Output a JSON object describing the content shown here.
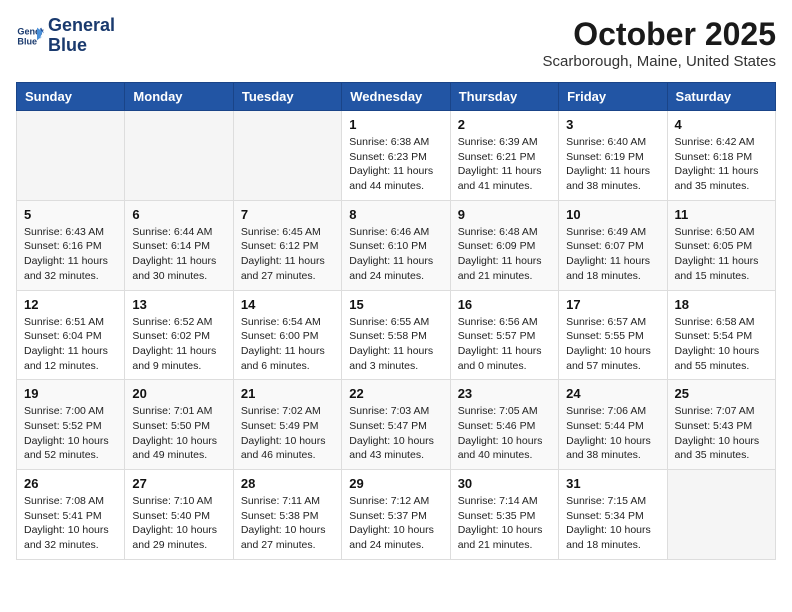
{
  "header": {
    "logo": {
      "line1": "General",
      "line2": "Blue"
    },
    "title": "October 2025",
    "location": "Scarborough, Maine, United States"
  },
  "weekdays": [
    "Sunday",
    "Monday",
    "Tuesday",
    "Wednesday",
    "Thursday",
    "Friday",
    "Saturday"
  ],
  "weeks": [
    [
      {
        "day": "",
        "info": ""
      },
      {
        "day": "",
        "info": ""
      },
      {
        "day": "",
        "info": ""
      },
      {
        "day": "1",
        "info": "Sunrise: 6:38 AM\nSunset: 6:23 PM\nDaylight: 11 hours\nand 44 minutes."
      },
      {
        "day": "2",
        "info": "Sunrise: 6:39 AM\nSunset: 6:21 PM\nDaylight: 11 hours\nand 41 minutes."
      },
      {
        "day": "3",
        "info": "Sunrise: 6:40 AM\nSunset: 6:19 PM\nDaylight: 11 hours\nand 38 minutes."
      },
      {
        "day": "4",
        "info": "Sunrise: 6:42 AM\nSunset: 6:18 PM\nDaylight: 11 hours\nand 35 minutes."
      }
    ],
    [
      {
        "day": "5",
        "info": "Sunrise: 6:43 AM\nSunset: 6:16 PM\nDaylight: 11 hours\nand 32 minutes."
      },
      {
        "day": "6",
        "info": "Sunrise: 6:44 AM\nSunset: 6:14 PM\nDaylight: 11 hours\nand 30 minutes."
      },
      {
        "day": "7",
        "info": "Sunrise: 6:45 AM\nSunset: 6:12 PM\nDaylight: 11 hours\nand 27 minutes."
      },
      {
        "day": "8",
        "info": "Sunrise: 6:46 AM\nSunset: 6:10 PM\nDaylight: 11 hours\nand 24 minutes."
      },
      {
        "day": "9",
        "info": "Sunrise: 6:48 AM\nSunset: 6:09 PM\nDaylight: 11 hours\nand 21 minutes."
      },
      {
        "day": "10",
        "info": "Sunrise: 6:49 AM\nSunset: 6:07 PM\nDaylight: 11 hours\nand 18 minutes."
      },
      {
        "day": "11",
        "info": "Sunrise: 6:50 AM\nSunset: 6:05 PM\nDaylight: 11 hours\nand 15 minutes."
      }
    ],
    [
      {
        "day": "12",
        "info": "Sunrise: 6:51 AM\nSunset: 6:04 PM\nDaylight: 11 hours\nand 12 minutes."
      },
      {
        "day": "13",
        "info": "Sunrise: 6:52 AM\nSunset: 6:02 PM\nDaylight: 11 hours\nand 9 minutes."
      },
      {
        "day": "14",
        "info": "Sunrise: 6:54 AM\nSunset: 6:00 PM\nDaylight: 11 hours\nand 6 minutes."
      },
      {
        "day": "15",
        "info": "Sunrise: 6:55 AM\nSunset: 5:58 PM\nDaylight: 11 hours\nand 3 minutes."
      },
      {
        "day": "16",
        "info": "Sunrise: 6:56 AM\nSunset: 5:57 PM\nDaylight: 11 hours\nand 0 minutes."
      },
      {
        "day": "17",
        "info": "Sunrise: 6:57 AM\nSunset: 5:55 PM\nDaylight: 10 hours\nand 57 minutes."
      },
      {
        "day": "18",
        "info": "Sunrise: 6:58 AM\nSunset: 5:54 PM\nDaylight: 10 hours\nand 55 minutes."
      }
    ],
    [
      {
        "day": "19",
        "info": "Sunrise: 7:00 AM\nSunset: 5:52 PM\nDaylight: 10 hours\nand 52 minutes."
      },
      {
        "day": "20",
        "info": "Sunrise: 7:01 AM\nSunset: 5:50 PM\nDaylight: 10 hours\nand 49 minutes."
      },
      {
        "day": "21",
        "info": "Sunrise: 7:02 AM\nSunset: 5:49 PM\nDaylight: 10 hours\nand 46 minutes."
      },
      {
        "day": "22",
        "info": "Sunrise: 7:03 AM\nSunset: 5:47 PM\nDaylight: 10 hours\nand 43 minutes."
      },
      {
        "day": "23",
        "info": "Sunrise: 7:05 AM\nSunset: 5:46 PM\nDaylight: 10 hours\nand 40 minutes."
      },
      {
        "day": "24",
        "info": "Sunrise: 7:06 AM\nSunset: 5:44 PM\nDaylight: 10 hours\nand 38 minutes."
      },
      {
        "day": "25",
        "info": "Sunrise: 7:07 AM\nSunset: 5:43 PM\nDaylight: 10 hours\nand 35 minutes."
      }
    ],
    [
      {
        "day": "26",
        "info": "Sunrise: 7:08 AM\nSunset: 5:41 PM\nDaylight: 10 hours\nand 32 minutes."
      },
      {
        "day": "27",
        "info": "Sunrise: 7:10 AM\nSunset: 5:40 PM\nDaylight: 10 hours\nand 29 minutes."
      },
      {
        "day": "28",
        "info": "Sunrise: 7:11 AM\nSunset: 5:38 PM\nDaylight: 10 hours\nand 27 minutes."
      },
      {
        "day": "29",
        "info": "Sunrise: 7:12 AM\nSunset: 5:37 PM\nDaylight: 10 hours\nand 24 minutes."
      },
      {
        "day": "30",
        "info": "Sunrise: 7:14 AM\nSunset: 5:35 PM\nDaylight: 10 hours\nand 21 minutes."
      },
      {
        "day": "31",
        "info": "Sunrise: 7:15 AM\nSunset: 5:34 PM\nDaylight: 10 hours\nand 18 minutes."
      },
      {
        "day": "",
        "info": ""
      }
    ]
  ]
}
